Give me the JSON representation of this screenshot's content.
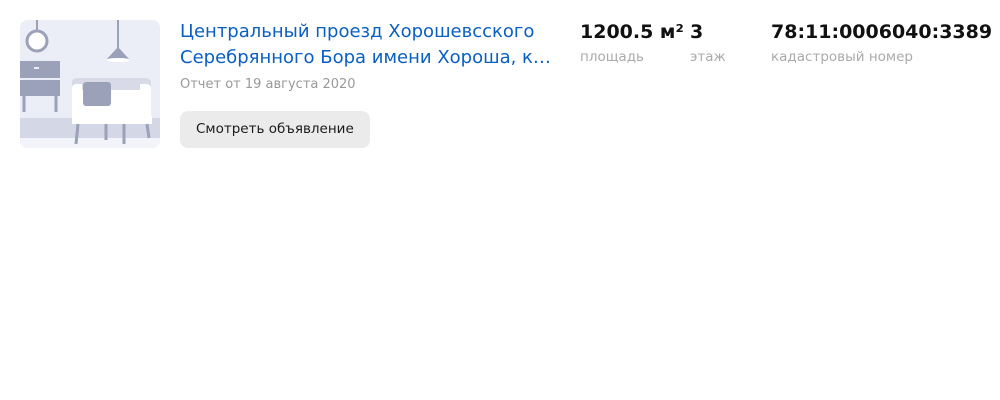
{
  "listing": {
    "title_line1": "Центральный проезд Хорошевсского",
    "title_line2": "Серебрянного Бора имени Хороша, ка...",
    "report_date": "Отчет от 19 августа 2020",
    "view_button_label": "Смотреть объявление",
    "thumbnail_icon": "room-interior-illustration"
  },
  "stats": {
    "area": {
      "value": "1200.5 м²",
      "label": "площадь"
    },
    "floor": {
      "value": "3",
      "label": "этаж"
    },
    "cadastral": {
      "value": "78:11:0006040:3389",
      "label": "кадастровый номер"
    }
  },
  "colors": {
    "link": "#0a5fc2",
    "muted_text": "#999999",
    "button_bg": "#ebebeb",
    "thumb_bg": "#ebeef7",
    "illustration_dark": "#9aa1b8",
    "illustration_light": "#ffffff"
  }
}
